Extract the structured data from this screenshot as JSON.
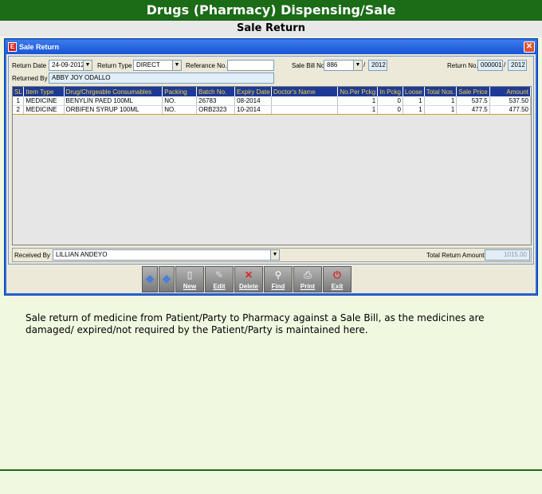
{
  "page": {
    "title": "Drugs (Pharmacy) Dispensing/Sale",
    "subtitle": "Sale Return"
  },
  "window": {
    "title": "Sale Return"
  },
  "form": {
    "return_date_label": "Return Date",
    "return_date": "24-09-2012",
    "return_type_label": "Return Type",
    "return_type": "DIRECT",
    "reference_label": "Referance No.",
    "reference_value": "",
    "sale_bill_label": "Sale Bill No.",
    "sale_bill_no": "886",
    "sale_bill_year": "2012",
    "sep": "/",
    "return_no_label": "Return No.",
    "return_no": "000001",
    "return_year": "2012",
    "returned_by_label": "Returned By",
    "returned_by": "ABBY JOY ODALLO"
  },
  "grid": {
    "columns": [
      "SL",
      "Item Type",
      "Drug/Chrgeable Consumables",
      "Packing",
      "Batch No.",
      "Expiry Date",
      "Doctor's Name",
      "No.Per Pckg",
      "In Pckg",
      "Loose",
      "Total Nos.",
      "Sale Price",
      "Amount"
    ],
    "rows": [
      [
        "1",
        "MEDICINE",
        "BENYLIN PAED 100ML",
        "NO.",
        "26783",
        "08-2014",
        "",
        "1",
        "0",
        "1",
        "1",
        "537.5",
        "537.50"
      ],
      [
        "2",
        "MEDICINE",
        "ORBIFEN SYRUP 100ML",
        "NO.",
        "ORB2323",
        "10-2014",
        "",
        "1",
        "0",
        "1",
        "1",
        "477.5",
        "477.50"
      ]
    ]
  },
  "bottom": {
    "received_by_label": "Received By",
    "received_by": "LILLIAN ANDEYO",
    "total_label": "Total Return Amount",
    "total_value": "1015.00"
  },
  "toolbar": {
    "new": "New",
    "edit": "Edit",
    "delete": "Delete",
    "find": "Find",
    "print": "Print",
    "exit": "Exit"
  },
  "description": "Sale return of medicine from Patient/Party to Pharmacy against a Sale Bill, as the medicines are damaged/ expired/not required by the Patient/Party is maintained here.",
  "colors": {
    "header_green": "#1b6b17",
    "grid_header": "#1d3a96",
    "grid_header_text": "#f4d03f"
  }
}
